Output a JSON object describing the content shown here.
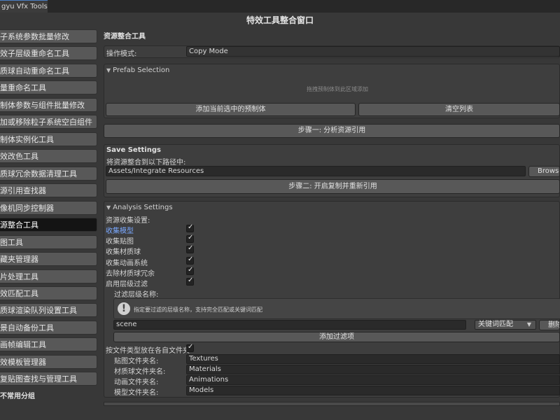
{
  "window": {
    "tab_title": "gyu Vfx Tools",
    "title": "特效工具整合窗口"
  },
  "sidebar": {
    "items": [
      {
        "label": "子系统参数批量修改"
      },
      {
        "label": "效子层级重命名工具"
      },
      {
        "label": "质球自动重命名工具"
      },
      {
        "label": "量重命名工具"
      },
      {
        "label": "制体参数与组件批量修改"
      },
      {
        "label": "加或移除粒子系统空白组件"
      },
      {
        "label": "制体实例化工具"
      },
      {
        "label": "效改色工具"
      },
      {
        "label": "质球冗余数据清理工具"
      },
      {
        "label": "源引用查找器"
      },
      {
        "label": "像机同步控制器"
      },
      {
        "label": "源整合工具"
      },
      {
        "label": "图工具"
      },
      {
        "label": "藏夹管理器"
      },
      {
        "label": "片处理工具"
      },
      {
        "label": "效匹配工具"
      },
      {
        "label": "质球渲染队列设置工具"
      },
      {
        "label": "景自动备份工具"
      },
      {
        "label": "画帧编辑工具"
      },
      {
        "label": "效模板管理器"
      },
      {
        "label": "复贴图查找与管理工具"
      }
    ],
    "footer": "不常用分组"
  },
  "main": {
    "section_title": "资源整合工具",
    "mode": {
      "label": "操作模式:",
      "value": "Copy Mode"
    },
    "prefab_selection": {
      "title": "Prefab Selection",
      "drop_hint": "拖拽预制体到此区域添加",
      "add_button": "添加当前选中的预制体",
      "clear_button": "清空列表"
    },
    "step1_button": "步骤一: 分析资源引用",
    "save_settings": {
      "title": "Save Settings",
      "path_label": "将资源整合到以下路径中:",
      "path_value": "Assets/Integrate Resources",
      "browse_button": "Browse",
      "step2_button": "步骤二: 开启复制并重新引用"
    },
    "analysis": {
      "title": "Analysis Settings",
      "collect_label": "资源收集设置:",
      "options": [
        {
          "label": "收集模型",
          "checked": true
        },
        {
          "label": "收集贴图",
          "checked": true
        },
        {
          "label": "收集材质球",
          "checked": true
        },
        {
          "label": "收集动画系统",
          "checked": true
        },
        {
          "label": "去除材质球冗余",
          "checked": true
        },
        {
          "label": "启用层级过滤",
          "checked": true
        }
      ],
      "filter_label": "过滤层级名称:",
      "help_text": "指定要过滤的层级名称，支持完全匹配或关键词匹配",
      "filter_value": "scene",
      "match_mode": "关键词匹配",
      "delete_button": "删除",
      "add_filter_button": "添加过滤项",
      "per_type_label": "按文件类型放在各自文件夹",
      "per_type_checked": true,
      "folders": [
        {
          "label": "贴图文件夹名:",
          "value": "Textures"
        },
        {
          "label": "材质球文件夹名:",
          "value": "Materials"
        },
        {
          "label": "动画文件夹名:",
          "value": "Animations"
        },
        {
          "label": "模型文件夹名:",
          "value": "Models"
        }
      ]
    }
  }
}
